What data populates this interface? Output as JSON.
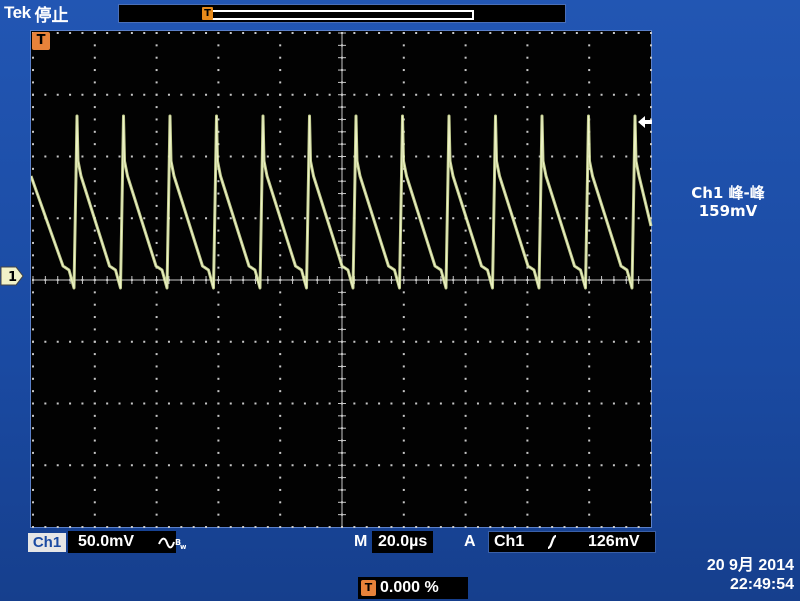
{
  "header": {
    "brand": "Tek",
    "acquisition_status": "停止"
  },
  "measurement": {
    "label": "Ch1 峰-峰",
    "value": "159mV"
  },
  "channel": {
    "name": "Ch1",
    "scale": "50.0mV",
    "coupling_icon": "ac-bandwidth-limit-icon"
  },
  "timebase": {
    "label": "M",
    "value": "20.0µs"
  },
  "trigger": {
    "label": "A",
    "source": "Ch1",
    "slope_icon": "rising-edge-icon",
    "level": "126mV",
    "marker": "T"
  },
  "horizontal_position": {
    "value": "0.000 %"
  },
  "clock": {
    "date": "20 9月  2014",
    "time": "22:49:54"
  },
  "ground_marker": "1",
  "colors": {
    "trace": "#d8e3a0",
    "grid": "#c8c8c8",
    "trigger_marker": "#e8823a",
    "background": "#1c4fa8"
  }
}
